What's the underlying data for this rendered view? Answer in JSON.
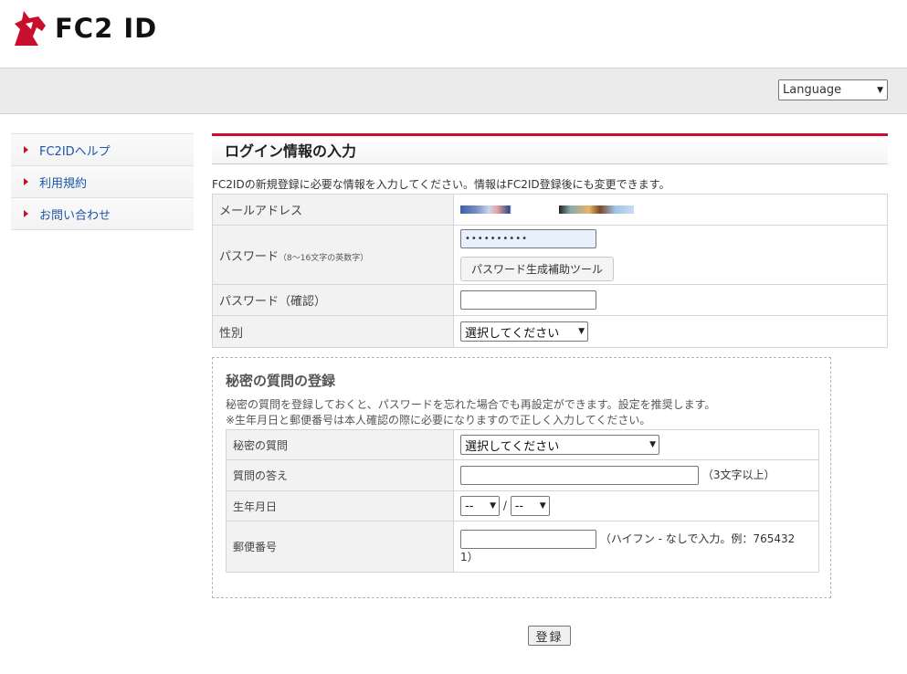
{
  "header": {
    "logo_text": "FC2 ID"
  },
  "language": {
    "selected": "Language"
  },
  "sidebar": {
    "items": [
      {
        "label": "FC2IDヘルプ"
      },
      {
        "label": "利用規約"
      },
      {
        "label": "お問い合わせ"
      }
    ]
  },
  "main": {
    "title": "ログイン情報の入力",
    "intro": "FC2IDの新規登録に必要な情報を入力してください。情報はFC2ID登録後にも変更できます。",
    "rows": {
      "email_label": "メールアドレス",
      "password_label": "パスワード",
      "password_hint": "（8～16文字の英数字）",
      "password_value": "••••••••••",
      "password_tool_button": "パスワード生成補助ツール",
      "password_confirm_label": "パスワード（確認）",
      "gender_label": "性別",
      "gender_selected": "選択してください"
    }
  },
  "secret": {
    "title": "秘密の質問の登録",
    "desc1": "秘密の質問を登録しておくと、パスワードを忘れた場合でも再設定ができます。設定を推奨します。",
    "desc2": "※生年月日と郵便番号は本人確認の際に必要になりますので正しく入力してください。",
    "question_label": "秘密の質問",
    "question_selected": "選択してください",
    "answer_label": "質問の答え",
    "answer_note": "（3文字以上）",
    "birth_label": "生年月日",
    "birth_month": "--",
    "birth_sep": "/",
    "birth_day": "--",
    "postal_label": "郵便番号",
    "postal_note_line1": "（ハイフン - なしで入力。例：765432",
    "postal_note_line2": "1）"
  },
  "submit": {
    "label": "登録"
  },
  "colors": {
    "accent": "#c8102e",
    "link": "#1a55a8"
  }
}
